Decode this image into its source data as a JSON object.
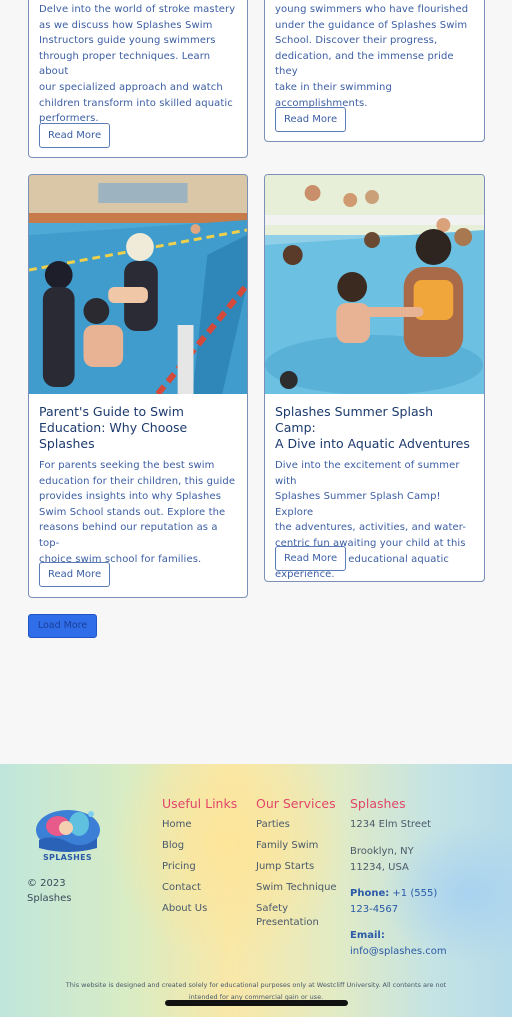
{
  "cards": [
    {
      "excerpt_lines": [
        "Delve into the world of stroke mastery",
        "as we discuss how Splashes Swim",
        "Instructors guide young swimmers",
        "through proper techniques. Learn about",
        "our specialized approach and watch",
        "children transform into skilled aquatic",
        "performers."
      ],
      "button": "Read More"
    },
    {
      "excerpt_lines": [
        "young swimmers who have flourished",
        "under the guidance of Splashes Swim",
        "School. Discover their progress,",
        "dedication, and the immense pride they",
        "take in their swimming",
        "accomplishments."
      ],
      "button": "Read More"
    },
    {
      "title_lines": [
        "Parent's Guide to Swim",
        "Education: Why Choose",
        "Splashes"
      ],
      "excerpt_lines": [
        "For parents seeking the best swim",
        "education for their children, this guide",
        "provides insights into why Splashes",
        "Swim School stands out. Explore the",
        "reasons behind our reputation as a top-",
        "choice swim school for families."
      ],
      "button": "Read More"
    },
    {
      "title_lines": [
        "Splashes Summer Splash Camp:",
        "A Dive into Aquatic Adventures"
      ],
      "excerpt_lines": [
        "Dive into the excitement of summer with",
        "Splashes Summer Splash Camp! Explore",
        "the adventures, activities, and water-",
        "centric fun awaiting your child at this",
        "engaging and educational aquatic",
        "experience."
      ],
      "button": "Read More"
    }
  ],
  "load_more": "Load More",
  "footer": {
    "logo_text": "SPLASHES",
    "copyright_lines": [
      "© 2023",
      "Splashes"
    ],
    "useful_links": {
      "title": "Useful Links",
      "items": [
        "Home",
        "Blog",
        "Pricing",
        "Contact",
        "About Us"
      ]
    },
    "our_services": {
      "title": "Our Services",
      "items": [
        "Parties",
        "Family Swim",
        "Jump Starts",
        "Swim Technique",
        "Safety",
        "Presentation"
      ]
    },
    "contact": {
      "title": "Splashes",
      "street": "1234 Elm Street",
      "city_lines": [
        "Brooklyn, NY",
        "11234, USA"
      ],
      "phone_label": "Phone:",
      "phone_value": "+1 (555)",
      "phone_value2": "123-4567",
      "email_label": "Email:",
      "email_value": "info@splashes.com"
    },
    "disclaimer_lines": [
      "This website is designed and created solely for educational purposes only at Westcliff University. All contents are not",
      "intended for any commercial gain or use."
    ]
  },
  "colors": {
    "accent": "#2f6ee8",
    "footer_heading": "#e2466a",
    "title": "#1c3a6e",
    "excerpt": "#3b5ea3"
  }
}
